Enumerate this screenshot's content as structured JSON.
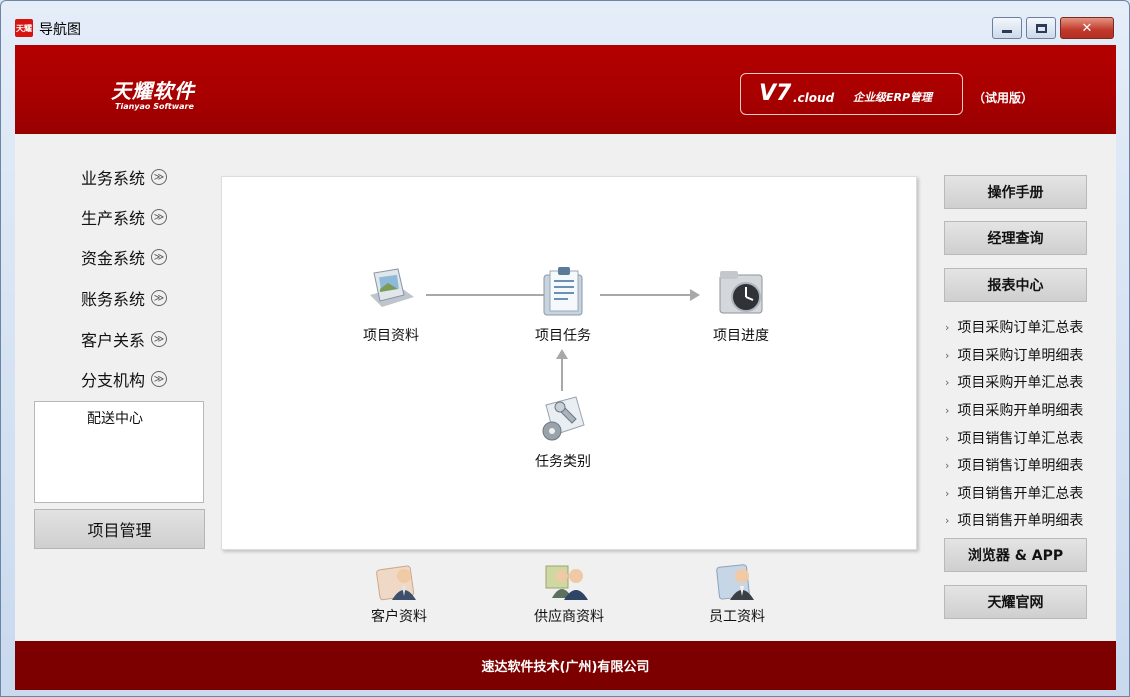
{
  "window": {
    "title": "导航图",
    "app_icon_text": "天耀",
    "close_glyph": "✕"
  },
  "header": {
    "logo_cn": "天耀软件",
    "logo_en": "Tianyao Software",
    "version_v7": "V7",
    "version_cloud": ".cloud",
    "version_erp": "企业级ERP管理",
    "trial": "（试用版）"
  },
  "sidebar": {
    "items": [
      {
        "label": "业务系统"
      },
      {
        "label": "生产系统"
      },
      {
        "label": "资金系统"
      },
      {
        "label": "账务系统"
      },
      {
        "label": "客户关系"
      },
      {
        "label": "分支机构"
      }
    ],
    "chevron_glyph": "≫",
    "sub_items": [
      "配送中心"
    ],
    "active_button": "项目管理"
  },
  "flow": {
    "nodes": [
      {
        "label": "项目资料",
        "icon": "project-data-icon"
      },
      {
        "label": "项目任务",
        "icon": "project-task-icon"
      },
      {
        "label": "项目进度",
        "icon": "project-progress-icon"
      },
      {
        "label": "任务类别",
        "icon": "task-category-icon"
      }
    ]
  },
  "bottom": {
    "items": [
      {
        "label": "客户资料",
        "icon": "customer-data-icon"
      },
      {
        "label": "供应商资料",
        "icon": "supplier-data-icon"
      },
      {
        "label": "员工资料",
        "icon": "employee-data-icon"
      }
    ]
  },
  "right": {
    "buttons": [
      "操作手册",
      "经理查询",
      "报表中心"
    ],
    "reports": [
      "项目采购订单汇总表",
      "项目采购订单明细表",
      "项目采购开单汇总表",
      "项目采购开单明细表",
      "项目销售订单汇总表",
      "项目销售订单明细表",
      "项目销售开单汇总表",
      "项目销售开单明细表"
    ],
    "bullet": "›",
    "browser_btn": "浏览器 & APP",
    "website_btn": "天耀官网"
  },
  "footer": {
    "company": "速达软件技术(广州)有限公司"
  },
  "colors": {
    "brand_red": "#a70000",
    "footer_red": "#7d0000"
  }
}
